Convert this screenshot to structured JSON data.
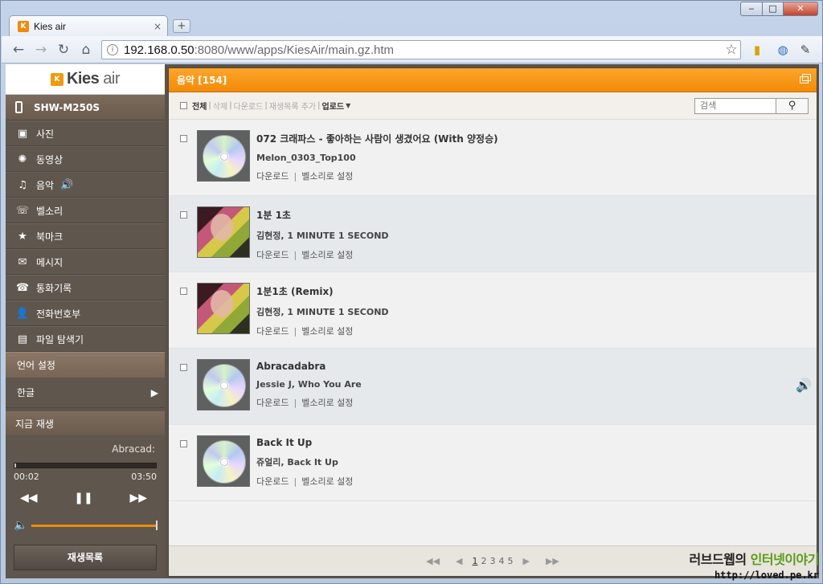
{
  "browser": {
    "tab_title": "Kies air",
    "tab_favicon": "K",
    "tab_close": "×",
    "newtab": "+",
    "url_host": "192.168.0.50",
    "url_path": ":8080/www/apps/KiesAir/main.gz.htm",
    "win_min": "‒",
    "win_max": "□",
    "win_close": "✕"
  },
  "app": {
    "logo": "Kies",
    "logo_suffix": "air",
    "device": "SHW-M250S",
    "menu": [
      {
        "label": "사진",
        "icon": "photo-icon"
      },
      {
        "label": "동영상",
        "icon": "video-icon"
      },
      {
        "label": "음악",
        "icon": "music-icon"
      },
      {
        "label": "벨소리",
        "icon": "ringtone-icon"
      },
      {
        "label": "북마크",
        "icon": "bookmark-icon"
      },
      {
        "label": "메시지",
        "icon": "message-icon"
      },
      {
        "label": "통화기록",
        "icon": "call-log-icon"
      },
      {
        "label": "전화번호부",
        "icon": "contacts-icon"
      },
      {
        "label": "파일 탐색기",
        "icon": "folder-icon"
      }
    ],
    "language_header": "언어 설정",
    "language_value": "한글",
    "now_playing_header": "지금 재생",
    "now_playing_title": "Abracad:",
    "time_elapsed": "00:02",
    "time_total": "03:50",
    "progress": 0.01,
    "volume": 1.0,
    "playlist_button": "재생목록"
  },
  "main": {
    "header": "음악 [154]",
    "actions": {
      "select_all": "전체",
      "delete": "삭제",
      "download": "다운로드",
      "add_playlist": "재생목록 추가",
      "upload": "업로드"
    },
    "search_placeholder": "검색",
    "songs": [
      {
        "title": "072 크래파스 - 좋아하는 사람이 생겼어요 (With 양정승)",
        "sub": "Melon_0303_Top100",
        "art": "cd"
      },
      {
        "title": "1분 1초",
        "sub": "김현정, 1 MINUTE 1 SECOND",
        "art": "photo"
      },
      {
        "title": "1분1초 (Remix)",
        "sub": "김현정, 1 MINUTE 1 SECOND",
        "art": "photo"
      },
      {
        "title": "Abracadabra",
        "sub": "Jessie J, Who You Are",
        "art": "cd",
        "playing": true
      },
      {
        "title": "Back It Up",
        "sub": "쥬얼리, Back It Up",
        "art": "cd"
      }
    ],
    "link_download": "다운로드",
    "link_ringtone": "벨소리로 설정",
    "pages": [
      "1",
      "2",
      "3",
      "4",
      "5"
    ],
    "current_page": "1"
  },
  "watermark": {
    "line1_a": "러브드웹의 ",
    "line1_b": "인터넷이야기",
    "line2": "http://loved.pe.kr"
  },
  "colors": {
    "accent": "#f28b07",
    "sidebar": "#5f574e",
    "row_alt": "#e5e9ec"
  }
}
